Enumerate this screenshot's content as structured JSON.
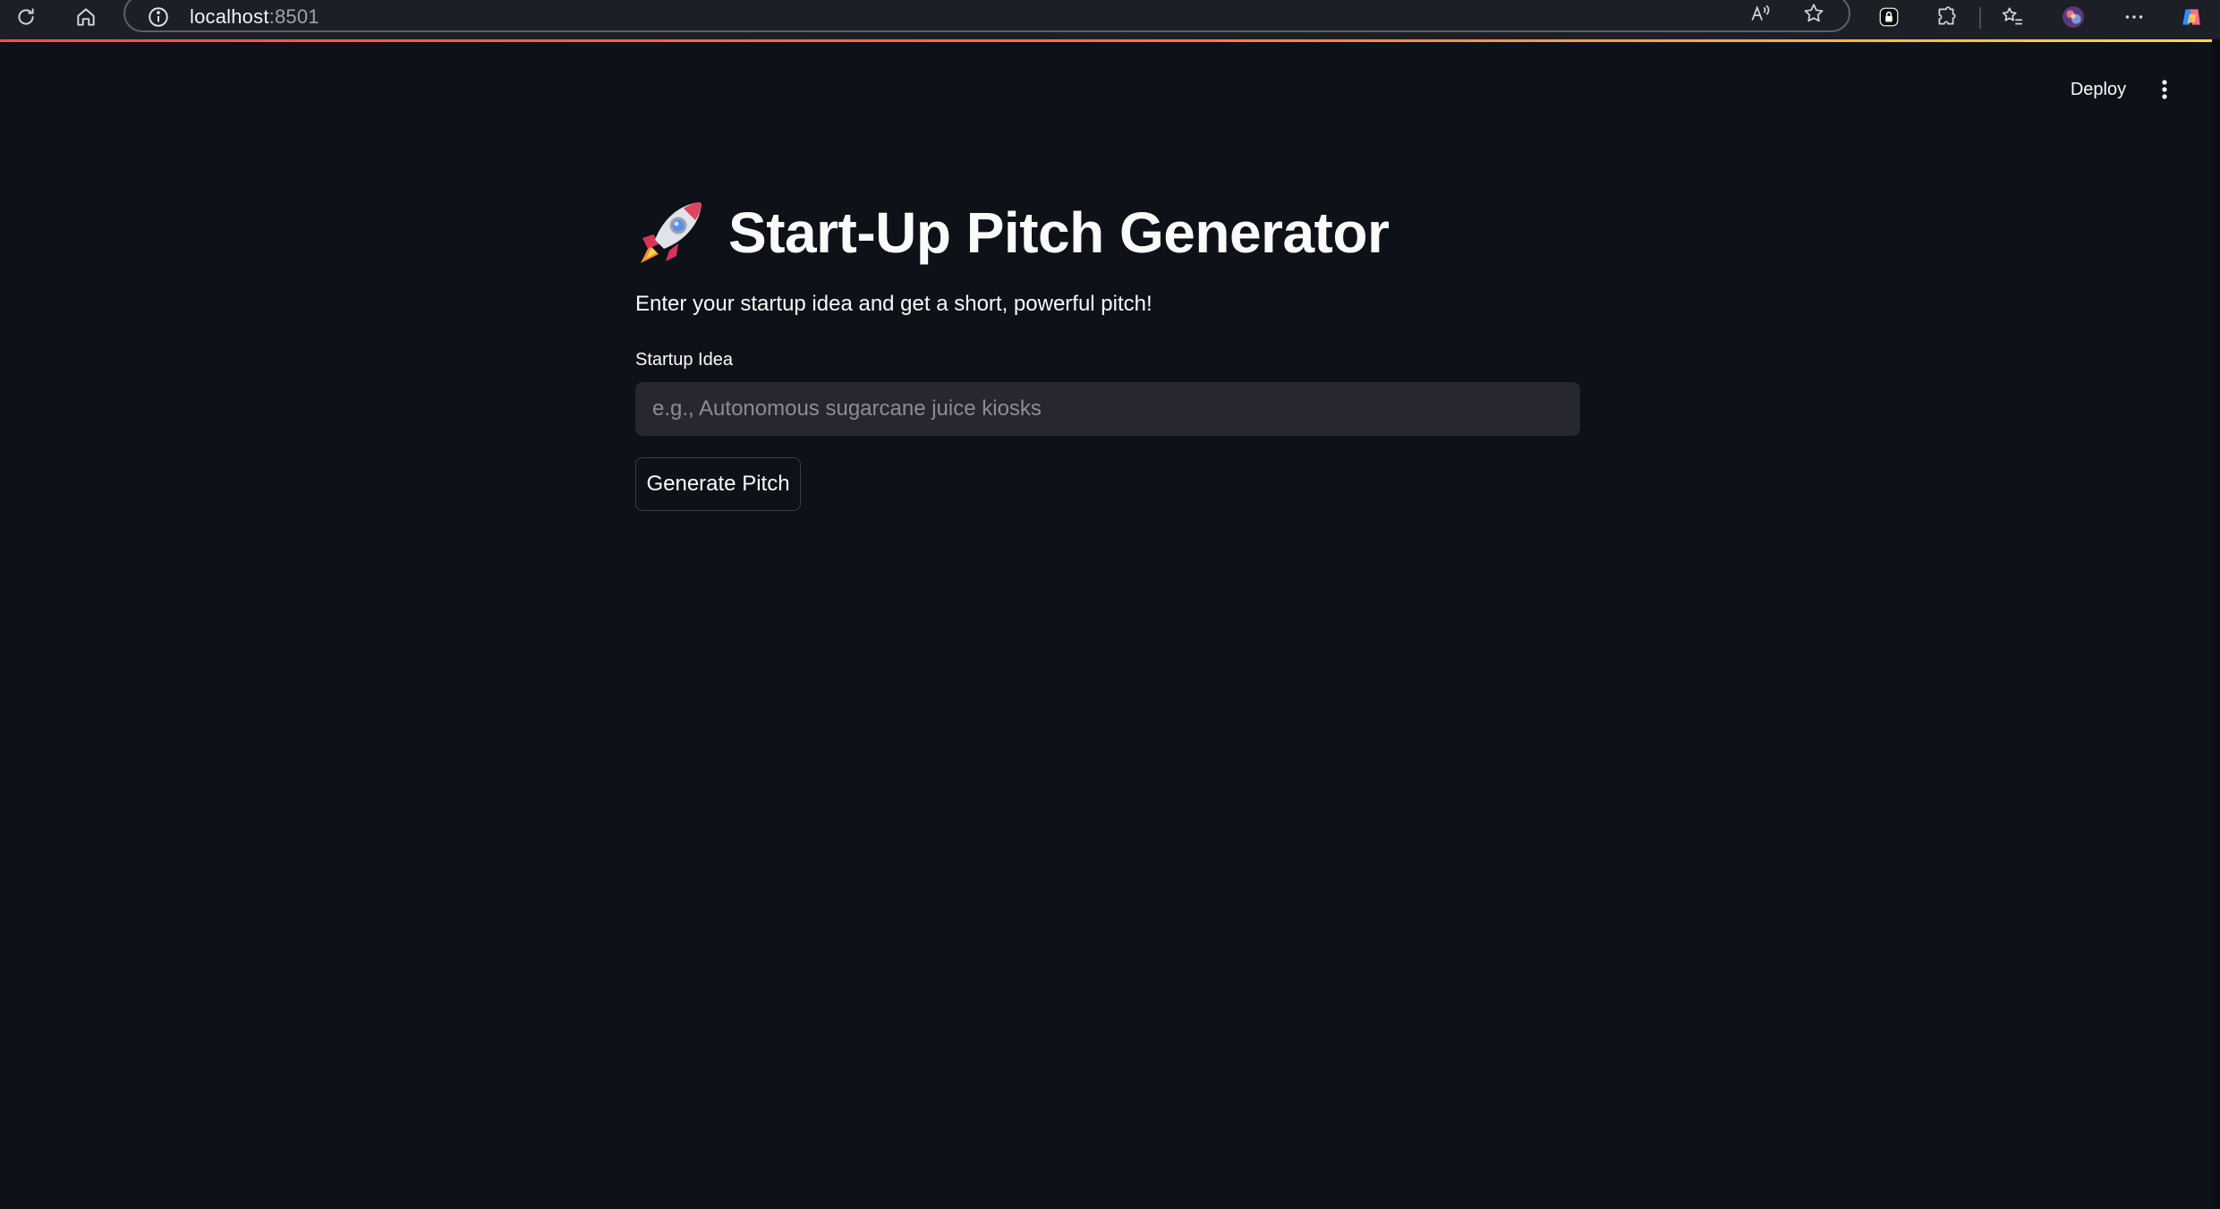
{
  "browser": {
    "url_host": "localhost",
    "url_port": ":8501",
    "icons": [
      "refresh-icon",
      "home-icon",
      "info-icon",
      "read-aloud-icon",
      "favorite-star-icon",
      "lock-extension-icon",
      "extensions-puzzle-icon",
      "favorites-list-icon",
      "profile-avatar",
      "more-options-icon",
      "copilot-icon"
    ]
  },
  "header": {
    "deploy_label": "Deploy",
    "menu_icon": "vertical-dots-icon"
  },
  "main": {
    "title_icon": "rocket-icon",
    "title": "Start-Up Pitch Generator",
    "subtitle": "Enter your startup idea and get a short, powerful pitch!",
    "input_label": "Startup Idea",
    "input_value": "",
    "input_placeholder": "e.g., Autonomous sugarcane juice kiosks",
    "button_label": "Generate Pitch"
  },
  "colors": {
    "background": "#0e1117",
    "input_bg": "#262730",
    "accent_red": "#ff4b4b",
    "accent_yellow": "#ffd74b"
  }
}
